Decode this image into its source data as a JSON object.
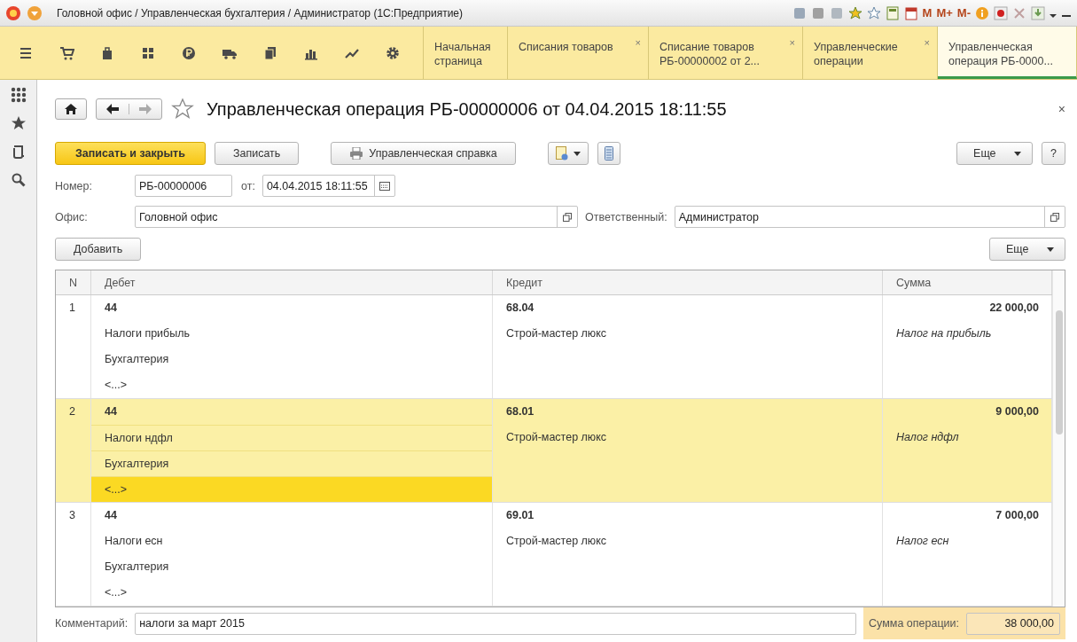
{
  "window": {
    "title": "Головной офис / Управленческая бухгалтерия / Администратор  (1С:Предприятие)",
    "memory_buttons": [
      "M",
      "M+",
      "M-"
    ]
  },
  "toolbar": {
    "tabs": [
      {
        "label": "Начальная страница",
        "selected": false
      },
      {
        "label": "Списания товаров",
        "selected": false,
        "close": "×"
      },
      {
        "label": "Списание товаров РБ-00000002 от 2...",
        "selected": false,
        "close": "×"
      },
      {
        "label": "Управленческие операции",
        "selected": false,
        "close": "×"
      },
      {
        "label": "Управленческая операция РБ-0000...",
        "selected": true
      }
    ]
  },
  "form": {
    "title": "Управленческая операция РБ-00000006 от 04.04.2015 18:11:55",
    "close": "×",
    "buttons": {
      "save_close": "Записать и закрыть",
      "save": "Записать",
      "report": "Управленческая справка",
      "more": "Еще",
      "help": "?"
    },
    "number_label": "Номер:",
    "number": "РБ-00000006",
    "date_label": "от:",
    "date": "04.04.2015 18:11:55",
    "office_label": "Офис:",
    "office": "Головной офис",
    "responsible_label": "Ответственный:",
    "responsible": "Администратор",
    "add_button": "Добавить",
    "table_more": "Еще"
  },
  "table": {
    "columns": [
      "N",
      "Дебет",
      "Кредит",
      "Сумма"
    ],
    "rows": [
      {
        "n": "1",
        "selected": false,
        "debit": [
          {
            "text": "44",
            "current": false
          },
          {
            "text": "Налоги прибыль",
            "current": false
          },
          {
            "text": "Бухгалтерия",
            "current": false
          },
          {
            "text": "<...>",
            "current": false
          }
        ],
        "credit": [
          "68.04",
          "Строй-мастер люкс"
        ],
        "amount": "22 000,00",
        "amount_note": "Налог на прибыль"
      },
      {
        "n": "2",
        "selected": true,
        "debit": [
          {
            "text": "44",
            "current": false
          },
          {
            "text": "Налоги ндфл",
            "current": false
          },
          {
            "text": "Бухгалтерия",
            "current": false
          },
          {
            "text": "<...>",
            "current": true
          }
        ],
        "credit": [
          "68.01",
          "Строй-мастер люкс"
        ],
        "amount": "9 000,00",
        "amount_note": "Налог ндфл"
      },
      {
        "n": "3",
        "selected": false,
        "debit": [
          {
            "text": "44",
            "current": false
          },
          {
            "text": "Налоги есн",
            "current": false
          },
          {
            "text": "Бухгалтерия",
            "current": false
          },
          {
            "text": "<...>",
            "current": false
          }
        ],
        "credit": [
          "69.01",
          "Строй-мастер люкс"
        ],
        "amount": "7 000,00",
        "amount_note": "Налог есн"
      }
    ]
  },
  "footer": {
    "comment_label": "Комментарий:",
    "comment": "налоги за март 2015",
    "total_label": "Сумма операции:",
    "total": "38 000,00"
  }
}
